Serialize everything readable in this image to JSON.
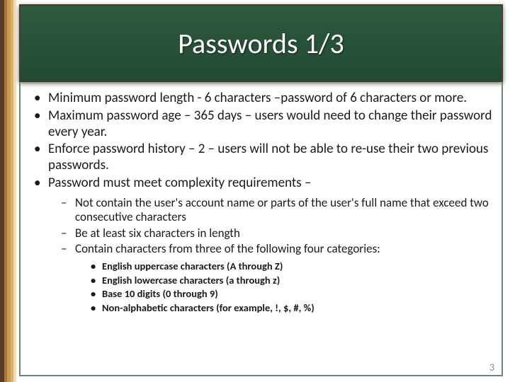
{
  "title": "Passwords 1/3",
  "page_number": "3",
  "bullets": [
    {
      "text": "Minimum password length - 6 characters –password of 6 characters or more."
    },
    {
      "text": "Maximum password age – 365 days – users would need to change their password every year."
    },
    {
      "text": "Enforce password history – 2 – users will not be able to re-use their two previous passwords."
    },
    {
      "text": "Password must meet complexity requirements –",
      "children": [
        {
          "text": "Not contain the user's account name or parts of the user's full name that exceed two consecutive characters"
        },
        {
          "text": "Be at least six characters in length"
        },
        {
          "text": "Contain characters from three of the following four categories:",
          "children": [
            {
              "text": "English uppercase characters (A through Z)"
            },
            {
              "text": "English lowercase characters (a through z)"
            },
            {
              "text": "Base 10 digits (0 through 9)"
            },
            {
              "text": "Non-alphabetic characters (for example, !, $, #, %)"
            }
          ]
        }
      ]
    }
  ]
}
